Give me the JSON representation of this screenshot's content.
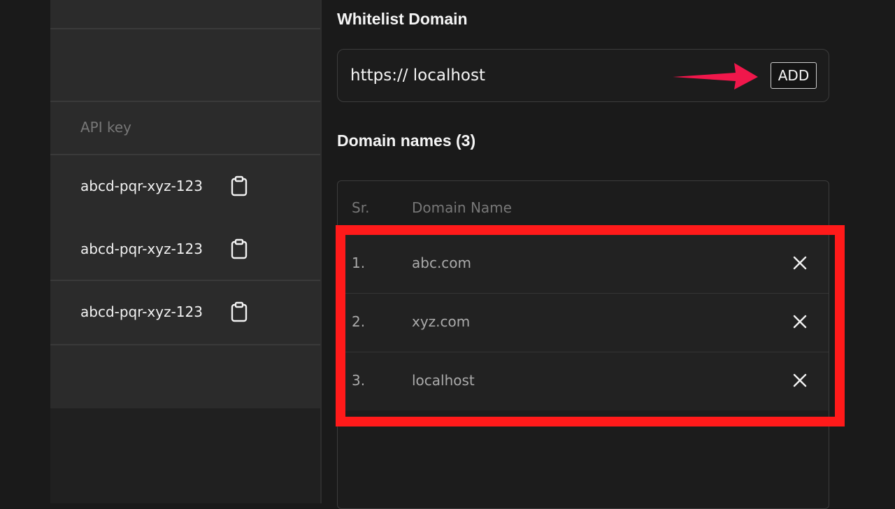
{
  "sidebar": {
    "api_key_header": "API key",
    "keys": [
      {
        "value": "abcd-pqr-xyz-123",
        "icon": "clipboard-icon"
      },
      {
        "value": "abcd-pqr-xyz-123",
        "icon": "clipboard-icon"
      },
      {
        "value": "abcd-pqr-xyz-123",
        "icon": "clipboard-icon"
      }
    ]
  },
  "whitelist": {
    "title": "Whitelist Domain",
    "input_value": "https:// localhost",
    "add_label": "ADD"
  },
  "domains": {
    "title": "Domain names (3)",
    "columns": [
      "Sr.",
      "Domain Name"
    ],
    "rows": [
      {
        "sr": "1.",
        "domain": "abc.com"
      },
      {
        "sr": "2.",
        "domain": "xyz.com"
      },
      {
        "sr": "3.",
        "domain": "localhost"
      }
    ]
  },
  "colors": {
    "highlight": "#ff1a1a",
    "arrow": "#f0174b",
    "background": "#1a1a1a"
  }
}
